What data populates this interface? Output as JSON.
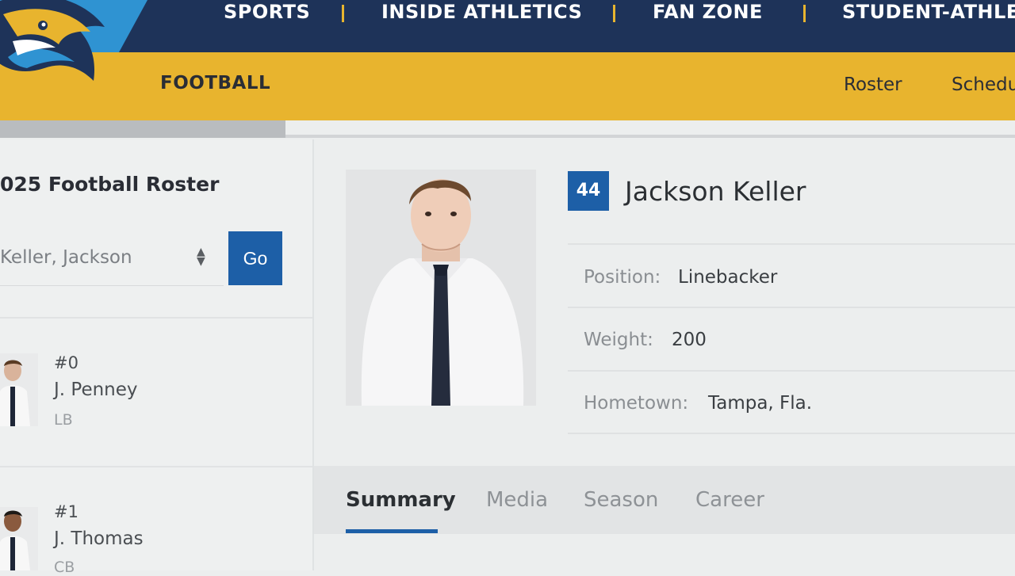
{
  "nav": {
    "items": [
      "SPORTS",
      "INSIDE ATHLETICS",
      "FAN ZONE",
      "STUDENT-ATHLE"
    ]
  },
  "subnav": {
    "sport": "FOOTBALL",
    "links": [
      "Roster",
      "Schedu"
    ]
  },
  "sidebar": {
    "heading": "025 Football Roster",
    "select": {
      "value": "Keller, Jackson"
    },
    "go_label": "Go",
    "players": [
      {
        "number": "#0",
        "name": "J. Penney",
        "position": "LB"
      },
      {
        "number": "#1",
        "name": "J. Thomas",
        "position": "CB"
      }
    ]
  },
  "player": {
    "jersey": "44",
    "name": "Jackson Keller",
    "details": [
      {
        "label": "Position:",
        "value": "Linebacker"
      },
      {
        "label": "Weight:",
        "value": "200"
      },
      {
        "label": "Hometown:",
        "value": "Tampa, Fla."
      }
    ]
  },
  "tabs": [
    "Summary",
    "Media",
    "Season",
    "Career"
  ],
  "colors": {
    "navy": "#1e3359",
    "gold": "#e8b42e",
    "accent_blue": "#1d5fa7"
  },
  "icons": [
    "hawk-logo-icon",
    "select-arrows-icon"
  ]
}
